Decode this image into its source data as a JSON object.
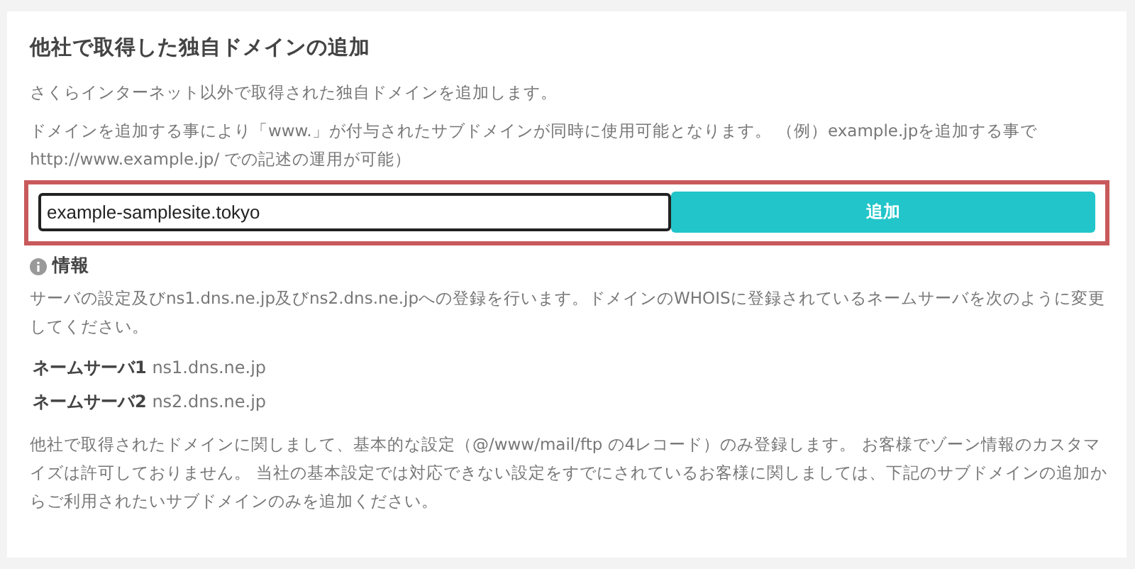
{
  "title": "他社で取得した独自ドメインの追加",
  "intro": [
    "さくらインターネット以外で取得された独自ドメインを追加します。",
    "ドメインを追加する事により「www.」が付与されたサブドメインが同時に使用可能となります。 （例）example.jpを追加する事で http://www.example.jp/ での記述の運用が可能）"
  ],
  "domain_field": {
    "value": "example-samplesite.tokyo"
  },
  "add_button": "追加",
  "info": {
    "heading": "情報",
    "text": "サーバの設定及びns1.dns.ne.jp及びns2.dns.ne.jpへの登録を行います。ドメインのWHOISに登録されているネームサーバを次のように変更してください。",
    "name_servers": [
      {
        "label": "ネームサーバ1",
        "value": "ns1.dns.ne.jp"
      },
      {
        "label": "ネームサーバ2",
        "value": "ns2.dns.ne.jp"
      }
    ],
    "note": "他社で取得されたドメインに関しまして、基本的な設定（@/www/mail/ftp の4レコード）のみ登録します。 お客様でゾーン情報のカスタマイズは許可しておりません。 当社の基本設定では対応できない設定をすでにされているお客様に関しましては、下記のサブドメインの追加からご利用されたいサブドメインのみを追加ください。"
  }
}
